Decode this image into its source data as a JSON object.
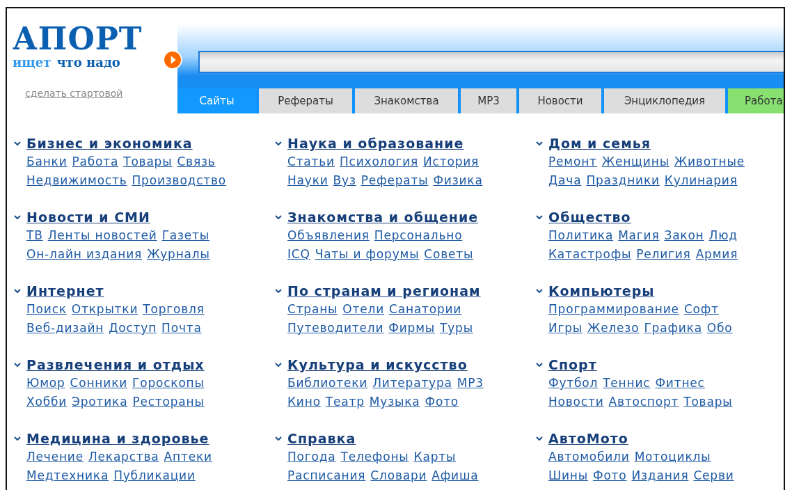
{
  "logo": {
    "name": "АПОРТ",
    "tagline": [
      {
        "text": "ищет",
        "color": "#3399ee"
      },
      {
        "text": "что надо",
        "color": "#0b5fb0"
      }
    ]
  },
  "start_page_link": "сделать стартовой",
  "tabs": [
    {
      "label": "Сайты",
      "selected": true,
      "color": "#1199ff"
    },
    {
      "label": "Рефераты",
      "selected": false,
      "color": "#dddddd"
    },
    {
      "label": "Знакомства",
      "selected": false,
      "color": "#dddddd"
    },
    {
      "label": "MP3",
      "selected": false,
      "color": "#dddddd"
    },
    {
      "label": "Новости",
      "selected": false,
      "color": "#dddddd"
    },
    {
      "label": "Энциклопедия",
      "selected": false,
      "color": "#dddddd"
    },
    {
      "label": "Работа",
      "selected": false,
      "color": "#88e070"
    }
  ],
  "categories": [
    {
      "title": "Бизнес и экономика",
      "links": [
        [
          "Банки",
          "Работа",
          "Товары",
          "Связь"
        ],
        [
          "Недвижимость",
          "Производство"
        ]
      ]
    },
    {
      "title": "Наука и образование",
      "links": [
        [
          "Статьи",
          "Психология",
          "История"
        ],
        [
          "Науки",
          "Вуз",
          "Рефераты",
          "Физика"
        ]
      ]
    },
    {
      "title": "Дом и семья",
      "links": [
        [
          "Ремонт",
          "Женщины",
          "Животные"
        ],
        [
          "Дача",
          "Праздники",
          "Кулинария"
        ]
      ]
    },
    {
      "title": "Новости и СМИ",
      "links": [
        [
          "ТВ",
          "Ленты новостей",
          "Газеты"
        ],
        [
          "Он-лайн издания",
          "Журналы"
        ]
      ]
    },
    {
      "title": "Знакомства и общение",
      "links": [
        [
          "Объявления",
          "Персонально"
        ],
        [
          "ICQ",
          "Чаты и форумы",
          "Советы"
        ]
      ]
    },
    {
      "title": "Общество",
      "links": [
        [
          "Политика",
          "Магия",
          "Закон",
          "Люд"
        ],
        [
          "Катастрофы",
          "Религия",
          "Армия"
        ]
      ]
    },
    {
      "title": "Интернет",
      "links": [
        [
          "Поиск",
          "Открытки",
          "Торговля"
        ],
        [
          "Веб-дизайн",
          "Доступ",
          "Почта"
        ]
      ]
    },
    {
      "title": "По странам и регионам",
      "links": [
        [
          "Страны",
          "Отели",
          "Санатории"
        ],
        [
          "Путеводители",
          "Фирмы",
          "Туры"
        ]
      ]
    },
    {
      "title": "Компьютеры",
      "links": [
        [
          "Программирование",
          "Софт"
        ],
        [
          "Игры",
          "Железо",
          "Графика",
          "Обо"
        ]
      ]
    },
    {
      "title": "Развлечения и отдых",
      "links": [
        [
          "Юмор",
          "Сонники",
          "Гороскопы"
        ],
        [
          "Хобби",
          "Эротика",
          "Рестораны"
        ]
      ]
    },
    {
      "title": "Культура и искусство",
      "links": [
        [
          "Библиотеки",
          "Литература",
          "MP3"
        ],
        [
          "Кино",
          "Театр",
          "Музыка",
          "Фото"
        ]
      ]
    },
    {
      "title": "Спорт",
      "links": [
        [
          "Футбол",
          "Теннис",
          "Фитнес"
        ],
        [
          "Новости",
          "Автоспорт",
          "Товары"
        ]
      ]
    },
    {
      "title": "Медицина и здоровье",
      "links": [
        [
          "Лечение",
          "Лекарства",
          "Аптеки"
        ],
        [
          "Медтехника",
          "Публикации"
        ]
      ]
    },
    {
      "title": "Справка",
      "links": [
        [
          "Погода",
          "Телефоны",
          "Карты"
        ],
        [
          "Расписания",
          "Словари",
          "Афиша"
        ]
      ]
    },
    {
      "title": "АвтоМото",
      "links": [
        [
          "Автомобили",
          "Мотоциклы"
        ],
        [
          "Шины",
          "Фото",
          "Издания",
          "Серви"
        ]
      ]
    }
  ]
}
